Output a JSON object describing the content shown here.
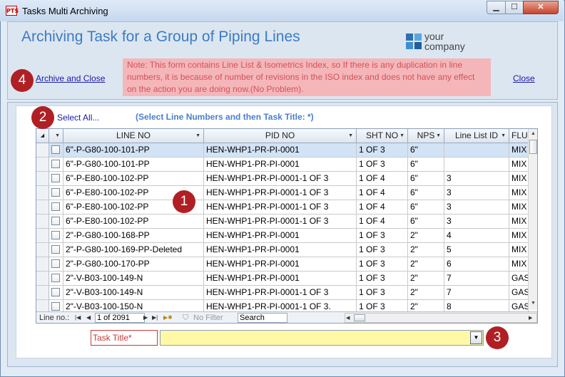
{
  "window": {
    "title": "Tasks Multi Archiving",
    "app_icon_text": "PTS"
  },
  "header": {
    "title": "Archiving Task for a Group of Piping Lines",
    "logo": {
      "line1": "your",
      "line2": "company",
      "colors": [
        "#2f6fb5",
        "#5aa6de",
        "#3d8fd1",
        "#1f5e9e"
      ]
    },
    "note": "Note: This form contains Line List & Isometrics Index, so If there is any duplication in line numbers, it is because of number of revisions in the ISO index and does not have any effect on the action you are doing now.(No Problem).",
    "archive_close": "Archive and Close",
    "close": "Close"
  },
  "badges": [
    "1",
    "2",
    "3",
    "4"
  ],
  "select_all": "Select All...",
  "hint": "(Select Line Numbers and then Task Title: *)",
  "grid": {
    "columns": [
      "LINE NO",
      "PID NO",
      "SHT NO",
      "NPS",
      "Line List ID",
      "FLUI"
    ],
    "rows": [
      [
        "6\"-P-G80-100-101-PP",
        "HEN-WHP1-PR-PI-0001",
        "1 OF 3",
        "6\"",
        "",
        "MIX"
      ],
      [
        "6\"-P-G80-100-101-PP",
        "HEN-WHP1-PR-PI-0001",
        "1 OF 3",
        "6\"",
        "",
        "MIX"
      ],
      [
        "6\"-P-E80-100-102-PP",
        "HEN-WHP1-PR-PI-0001-1 OF 3",
        "1 OF 4",
        "6\"",
        "3",
        "MIX"
      ],
      [
        "6\"-P-E80-100-102-PP",
        "HEN-WHP1-PR-PI-0001-1 OF 3",
        "1 OF 4",
        "6\"",
        "3",
        "MIX"
      ],
      [
        "6\"-P-E80-100-102-PP",
        "HEN-WHP1-PR-PI-0001-1 OF 3",
        "1 OF 4",
        "6\"",
        "3",
        "MIX"
      ],
      [
        "6\"-P-E80-100-102-PP",
        "HEN-WHP1-PR-PI-0001-1 OF 3",
        "1 OF 4",
        "6\"",
        "3",
        "MIX"
      ],
      [
        "2\"-P-G80-100-168-PP",
        "HEN-WHP1-PR-PI-0001",
        "1 OF 3",
        "2\"",
        "4",
        "MIX"
      ],
      [
        "2\"-P-G80-100-169-PP-Deleted",
        "HEN-WHP1-PR-PI-0001",
        "1 OF 3",
        "2\"",
        "5",
        "MIX"
      ],
      [
        "2\"-P-G80-100-170-PP",
        "HEN-WHP1-PR-PI-0001",
        "1 OF 3",
        "2\"",
        "6",
        "MIX"
      ],
      [
        "2\"-V-B03-100-149-N",
        "HEN-WHP1-PR-PI-0001",
        "1 OF 3",
        "2\"",
        "7",
        "GAS"
      ],
      [
        "2\"-V-B03-100-149-N",
        "HEN-WHP1-PR-PI-0001-1 OF 3",
        "1 OF 3",
        "2\"",
        "7",
        "GAS"
      ],
      [
        "2\"-V-B03-100-150-N",
        "HEN-WHP1-PR-PI-0001-1 OF 3.",
        "1 OF 3",
        "2\"",
        "8",
        "GAS"
      ]
    ]
  },
  "nav": {
    "label": "Line no.:",
    "record": "1 of 2091",
    "no_filter": "No Filter",
    "search": "Search"
  },
  "task": {
    "label": "Task Title*",
    "value": ""
  }
}
